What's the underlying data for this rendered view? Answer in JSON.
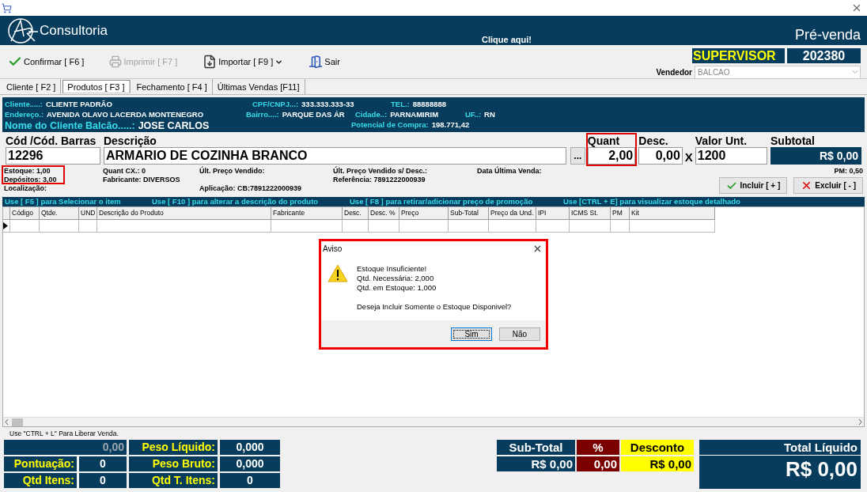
{
  "header": {
    "brand": "Consultoria",
    "link": "Clique aqui!",
    "module": "Pré-venda"
  },
  "toolbar": [
    {
      "kind": "confirm",
      "label": "Confirmar [ F6 ]",
      "disabled": false,
      "dropdown": false
    },
    {
      "kind": "print",
      "label": "Imprimir  [ F7 ]",
      "disabled": true,
      "dropdown": false
    },
    {
      "kind": "import",
      "label": "Importar [ F9 ]",
      "disabled": false,
      "dropdown": true
    },
    {
      "kind": "exit",
      "label": "Sair",
      "disabled": false,
      "dropdown": false
    }
  ],
  "user": {
    "role": "SUPERVISOR",
    "code": "202380",
    "seller_label": "Vendedor",
    "seller": "BALCAO"
  },
  "tabs": [
    {
      "label": "Cliente [ F2 ]",
      "selected": false
    },
    {
      "label": "Produtos [ F3 ]",
      "selected": true
    },
    {
      "label": "Fechamento [ F4 ]",
      "selected": false
    },
    {
      "label": "Últimas Vendas [F11]",
      "selected": false
    }
  ],
  "client": [
    [
      {
        "label": "Cliente.....:",
        "value": "CLIENTE PADRÃO"
      },
      {
        "label": "CPF/CNPJ...:",
        "value": "333.333.333-33"
      },
      {
        "label": "TEL.:",
        "value": "88888888"
      }
    ],
    [
      {
        "label": "Endereço.:",
        "value": "AVENIDA OLAVO LACERDA MONTENEGRO"
      },
      {
        "label": "Bairro....:",
        "value": "PARQUE DAS ÁR"
      },
      {
        "label": "Cidade..:",
        "value": "PARNAMIRIM"
      },
      {
        "label": "UF..:",
        "value": "RN"
      }
    ],
    [
      {
        "label": "Nome do Cliente Balcão.....:",
        "value": "JOSE CARLOS"
      },
      {
        "label": "Potencial de Compra:",
        "value": "198.771,42"
      }
    ]
  ],
  "entry": {
    "code": {
      "label": "Cód /Cód. Barras",
      "value": "12296"
    },
    "description": {
      "label": "Descrição",
      "value": "ARMARIO DE COZINHA BRANCO"
    },
    "search_button": "...",
    "quantity": {
      "label": "Quant",
      "value": "2,00",
      "highlighted": true
    },
    "discount": {
      "label": "Desc.",
      "value": "0,00"
    },
    "times": "X",
    "unit_price": {
      "label": "Valor Unt.",
      "value": "1200"
    },
    "subtotal": {
      "label": "Subtotal",
      "value": "R$ 0,00"
    }
  },
  "info": {
    "stock_highlighted": true,
    "stock": {
      "label": "Estoque:",
      "value": "1,00"
    },
    "deposits": {
      "label": "Depósitos:",
      "value": "3,00"
    },
    "location": {
      "label": "Localização:"
    },
    "box_qty": {
      "label": "Quant CX.:",
      "value": "0"
    },
    "manufacturer": {
      "label": "Fabricante:",
      "value": "DIVERSOS"
    },
    "last_price": {
      "label": "Últ. Preço Vendido:"
    },
    "application": {
      "label": "Aplicação:",
      "value": "CB:7891222000939"
    },
    "last_price_net": {
      "label": "Últ. Preço Vendido s/ Desc.:"
    },
    "reference": {
      "label": "Referência:",
      "value": "7891222000939"
    },
    "last_sale": {
      "label": "Data Última Venda:"
    },
    "pm": {
      "label": "PM:",
      "value": "0,50"
    }
  },
  "actions": [
    {
      "kind": "add",
      "label": "Incluir [ + ]"
    },
    {
      "kind": "remove",
      "label": "Excluir [ - ]"
    }
  ],
  "hints": [
    "Use [ F5 ] para Selecionar o item",
    "Use [ F10 ] para alterar a descrição do produto",
    "Use [ F8 ] para retirar/adicionar preço de promoção",
    "Use [CTRL + E] para visualizar estoque detalhado"
  ],
  "table": {
    "columns": [
      "Código",
      "Qtde.",
      "UND",
      "Descrição do Produto",
      "Fabricante",
      "Desc.",
      "Desc. %",
      "Preço",
      "Sub-Total",
      "Preço da Und.",
      "IPI",
      "ICMS St.",
      "PM",
      "Kit"
    ]
  },
  "footer_note": "Use \"CTRL + L\" Para Liberar Venda.",
  "totals_left": {
    "rows": [
      [
        {
          "value": "0,00"
        },
        {
          "label": "Peso Líquido:",
          "value": "0,000"
        }
      ],
      [
        {
          "label": "Pontuação:",
          "value": "0"
        },
        {
          "label": "Peso Bruto:",
          "value": "0,000"
        }
      ],
      [
        {
          "label": "Qtd Itens:",
          "value": "0"
        },
        {
          "label": "Qtd T. Itens:",
          "value": "0"
        }
      ]
    ]
  },
  "totals_right": {
    "subtotal": {
      "label": "Sub-Total",
      "value": "R$ 0,00"
    },
    "percent": {
      "label": "%",
      "value": "0,00"
    },
    "discount": {
      "label": "Desconto",
      "value": "R$ 0,00"
    },
    "total": {
      "label": "Total Líquido",
      "value": "R$ 0,00"
    }
  },
  "dialog": {
    "title": "Aviso",
    "highlighted": true,
    "message": [
      "Estoque Insuficiente!",
      "Qtd. Necessária: 2,000",
      "Qtd. em Estoque: 1,000"
    ],
    "question": "Deseja Incluir Somente o Estoque Disponivel?",
    "buttons": [
      {
        "label": "Sim",
        "focused": true
      },
      {
        "label": "Não",
        "focused": false
      }
    ]
  }
}
